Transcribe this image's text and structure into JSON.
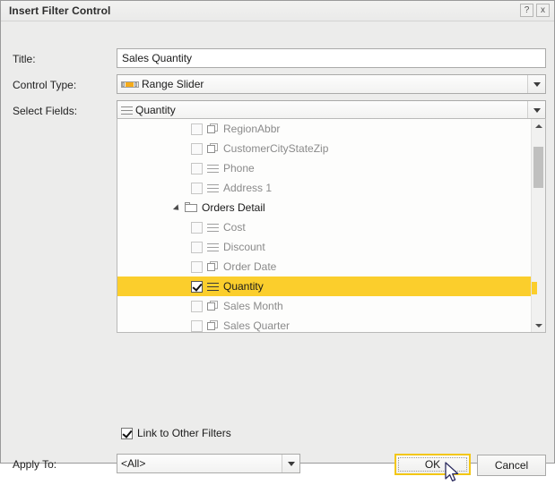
{
  "window": {
    "title": "Insert Filter Control",
    "help_button": "?",
    "close_button": "x"
  },
  "form": {
    "title_label": "Title:",
    "title_value": "Sales Quantity",
    "title_placeholder": "",
    "control_type_label": "Control Type:",
    "control_type_value": "Range Slider",
    "control_type_icon": "range-slider-icon",
    "select_fields_label": "Select Fields:",
    "select_fields_value": "Quantity",
    "select_fields_icon": "lines-icon",
    "apply_to_label": "Apply To:",
    "apply_to_value": "<All>",
    "link_filters_label": "Link to Other Filters",
    "link_filters_checked": true
  },
  "field_tree": {
    "items": [
      {
        "label": "RegionAbbr",
        "icon": "table-icon",
        "checked": false,
        "type": "field",
        "indent": 82
      },
      {
        "label": "CustomerCityStateZip",
        "icon": "table-icon",
        "checked": false,
        "type": "field",
        "indent": 82
      },
      {
        "label": "Phone",
        "icon": "lines-icon",
        "checked": false,
        "type": "field",
        "indent": 82
      },
      {
        "label": "Address 1",
        "icon": "lines-icon",
        "checked": false,
        "type": "field",
        "indent": 82
      },
      {
        "label": "Orders Detail",
        "icon": "folder-icon",
        "checked": false,
        "type": "group",
        "indent": 62
      },
      {
        "label": "Cost",
        "icon": "lines-icon",
        "checked": false,
        "type": "field",
        "indent": 82
      },
      {
        "label": "Discount",
        "icon": "lines-icon",
        "checked": false,
        "type": "field",
        "indent": 82
      },
      {
        "label": "Order Date",
        "icon": "table-icon",
        "checked": false,
        "type": "field",
        "indent": 82
      },
      {
        "label": "Quantity",
        "icon": "lines-icon",
        "checked": true,
        "type": "field",
        "indent": 82,
        "selected": true
      },
      {
        "label": "Sales Month",
        "icon": "table-icon",
        "checked": false,
        "type": "field",
        "indent": 82
      },
      {
        "label": "Sales Quarter",
        "icon": "table-icon",
        "checked": false,
        "type": "field",
        "indent": 82
      }
    ]
  },
  "buttons": {
    "ok": "OK",
    "cancel": "Cancel"
  },
  "colors": {
    "highlight": "#FBCE2C",
    "accent": "#F5AB1A",
    "focus_border": "#F3C714",
    "dialog_bg": "#ECECEB",
    "panel_bg": "#FDFDFC"
  }
}
